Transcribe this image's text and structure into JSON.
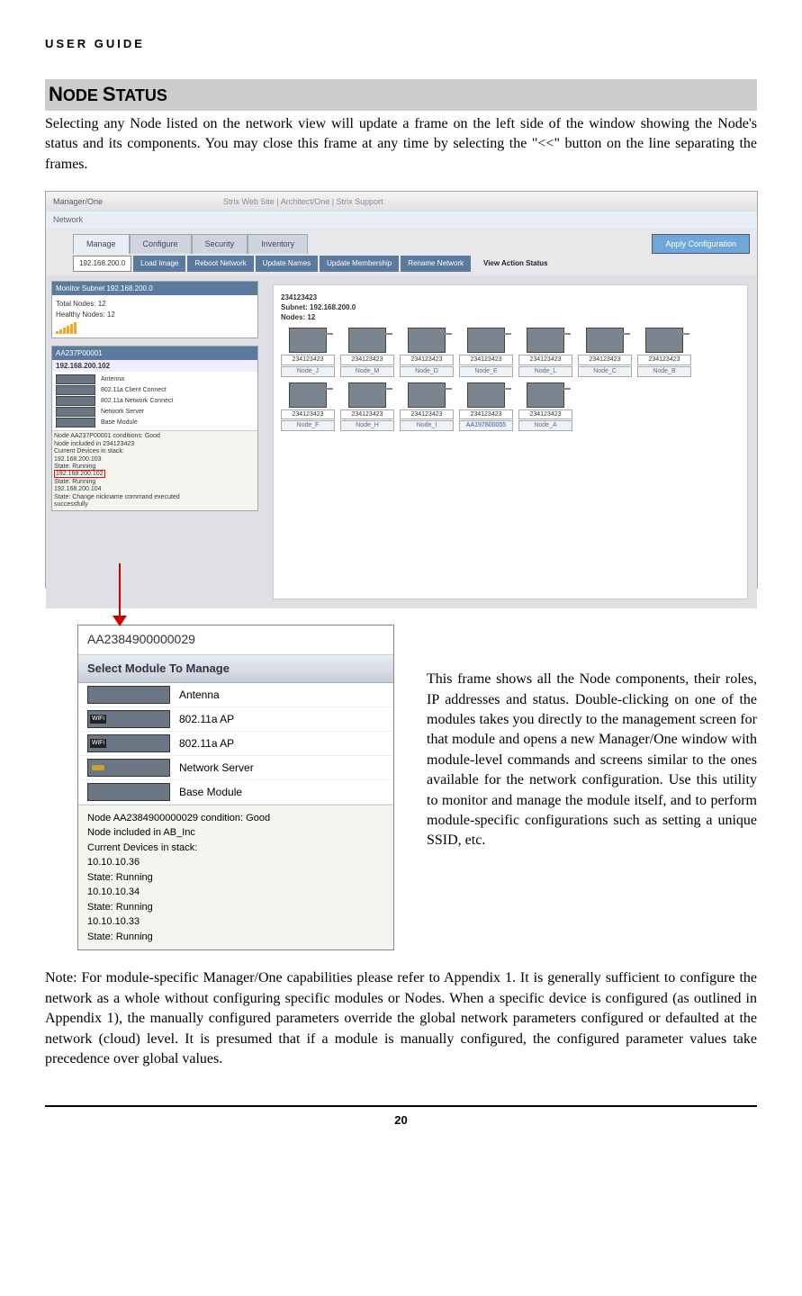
{
  "header": "USER GUIDE",
  "section": {
    "letter1": "N",
    "rest1": "ODE ",
    "letter2": "S",
    "rest2": "TATUS"
  },
  "para1": "Selecting any Node listed on the network view will update a frame on the left side of the window showing the Node's status and its components. You may close this frame at any time by selecting the \"<<\" button on the line separating the frames.",
  "ss1": {
    "title": "Manager/One",
    "links": "Strix Web Site  |  Architect/One  |  Strix Support",
    "network": "Network",
    "tabs": {
      "manage": "Manage",
      "configure": "Configure",
      "security": "Security",
      "inventory": "Inventory"
    },
    "apply": "Apply Configuration",
    "ip": "192.168.200.0",
    "buttons": {
      "load": "Load Image",
      "reboot": "Reboot Network",
      "names": "Update Names",
      "member": "Update Membership",
      "rename": "Rename Network"
    },
    "view": "View Action Status",
    "monitor_title": "Monitor Subnet 192.168.200.0",
    "total": "Total Nodes: 12",
    "healthy": "Healthy Nodes: 12",
    "node_name": "AA237P00001",
    "node_ip": "192.168.200.102",
    "mods": {
      "ant": "Antenna",
      "cc": "802.11a Client Connect",
      "nc": "802.11a Network Connect",
      "ns": "Network Server",
      "bm": "Base Module"
    },
    "status1": "Node AA237P00001 conditions: Good",
    "status2": "Node included in 234123423",
    "status3": "Current Devices in stack:",
    "status4": "192.168.200.103",
    "status5": "  State: Running",
    "status6": "192.168.200.102",
    "status7": "  State: Running",
    "status8": "192.168.200.104",
    "status9": "  State: Change nickname command executed",
    "status10": "successfully",
    "subnet1": "234123423",
    "subnet2": "Subnet: 192.168.200.0",
    "subnet3": "Nodes: 12",
    "nodelabel": "234123423",
    "names": [
      "Node_J",
      "Node_M",
      "Node_D",
      "Node_E",
      "Node_L",
      "Node_C",
      "Node_B",
      "Node_F",
      "Node_H",
      "Node_I",
      "AA197800055",
      "Node_A"
    ]
  },
  "ss2": {
    "head": "AA2384900000029",
    "sub": "Select Module To Manage",
    "mods": {
      "ant": "Antenna",
      "ap1": "802.11a AP",
      "ap2": "802.11a AP",
      "ns": "Network Server",
      "bm": "Base Module"
    },
    "s1": "Node AA2384900000029 condition: Good",
    "s2": "Node included in AB_Inc",
    "s3": "Current Devices in stack:",
    "s4": "10.10.10.36",
    "s5": "  State: Running",
    "s6": "10.10.10.34",
    "s7": "  State: Running",
    "s8": "10.10.10.33",
    "s9": "  State: Running"
  },
  "side": "This frame shows all the Node components, their roles, IP addresses and status. Double-clicking on one of the modules takes you directly to the management screen for that module and opens a new Manager/One window with module-level commands and screens similar to the ones available for the network configuration. Use this utility to monitor and manage the module itself, and to perform module-specific configurations such as setting a unique SSID, etc.",
  "note": "Note: For module-specific Manager/One capabilities please refer to Appendix 1. It is generally sufficient to configure the network as a whole without configuring specific modules or Nodes. When a specific device is configured (as outlined in Appendix 1), the manually configured parameters override the global network parameters configured or defaulted at the network (cloud) level. It is presumed that if a module is manually configured, the configured parameter values take precedence over global values.",
  "page": "20"
}
